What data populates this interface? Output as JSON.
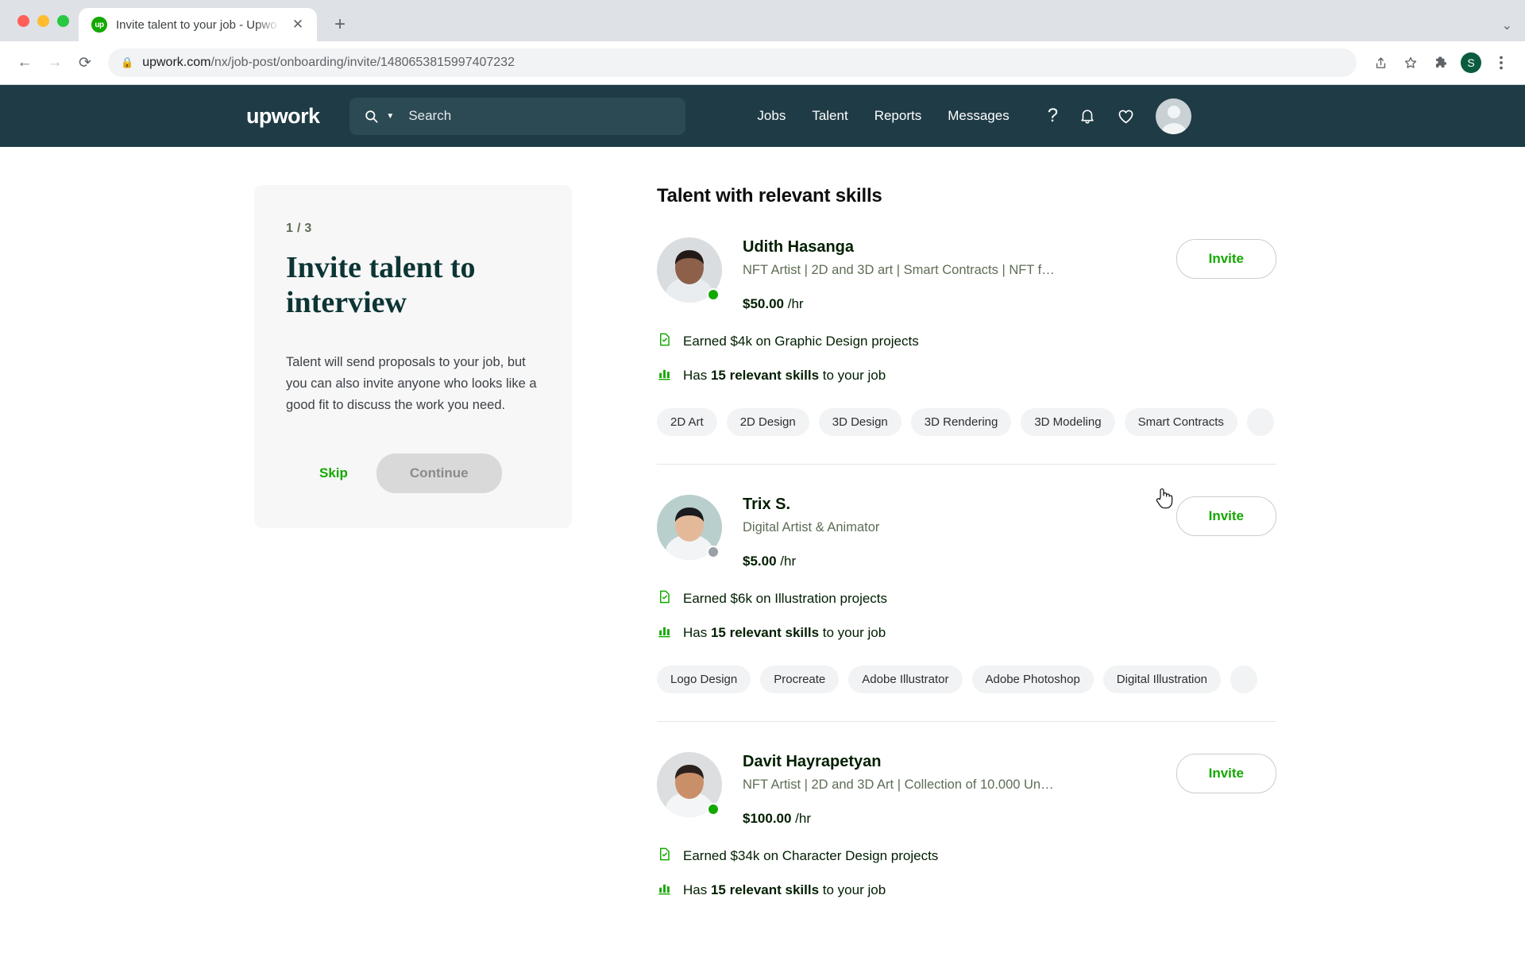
{
  "browser": {
    "tab": {
      "title": "Invite talent to your job - Upwo",
      "favicon_label": "up",
      "close_icon": "close-icon"
    },
    "new_tab_label": "+",
    "tabstrip_menu_icon": "chevron-down-icon",
    "back_icon": "back-arrow-icon",
    "forward_icon": "forward-arrow-icon",
    "reload_icon": "reload-icon",
    "lock_icon": "lock-icon",
    "url_host": "upwork.com",
    "url_path": "/nx/job-post/onboarding/invite/1480653815997407232",
    "url_full": "upwork.com/nx/job-post/onboarding/invite/1480653815997407232",
    "share_icon": "share-icon",
    "bookmark_icon": "star-icon",
    "extensions_icon": "puzzle-icon",
    "profile_initial": "S",
    "menu_icon": "three-dot-menu-icon"
  },
  "header": {
    "logo": "upwork",
    "search_placeholder": "Search",
    "search_icon": "search-icon",
    "search_caret_icon": "chevron-down-icon",
    "nav": [
      {
        "label": "Jobs"
      },
      {
        "label": "Talent"
      },
      {
        "label": "Reports"
      },
      {
        "label": "Messages"
      }
    ],
    "help_icon": "question-mark-icon",
    "notifications_icon": "bell-icon",
    "favorites_icon": "heart-icon",
    "avatar_icon": "user-avatar",
    "bg_color": "#1f3b45"
  },
  "side_card": {
    "step": "1 / 3",
    "title": "Invite talent to interview",
    "body": "Talent will send proposals to your job, but you can also invite anyone who looks like a good fit to discuss the work you need.",
    "skip_label": "Skip",
    "continue_label": "Continue",
    "skip_color": "#14a800"
  },
  "main": {
    "title": "Talent with relevant skills",
    "invite_label": "Invite",
    "next_skills_icon": "chevron-right-icon",
    "earnings_icon": "earnings-badge-icon",
    "skills_icon": "bar-chart-icon",
    "talent": [
      {
        "name": "Udith Hasanga",
        "tagline": "NFT Artist | 2D and 3D art | Smart Contracts | NFT f…",
        "rate": "$50.00",
        "rate_unit": "/hr",
        "status": "online",
        "earnings": "Earned $4k on Graphic Design projects",
        "skills_count_prefix": "Has ",
        "skills_count_bold": "15 relevant skills",
        "skills_count_suffix": " to your job",
        "skills": [
          "2D Art",
          "2D Design",
          "3D Design",
          "3D Rendering",
          "3D Modeling",
          "Smart Contracts"
        ]
      },
      {
        "name": "Trix S.",
        "tagline": "Digital Artist & Animator",
        "rate": "$5.00",
        "rate_unit": "/hr",
        "status": "offline",
        "earnings": "Earned $6k on Illustration projects",
        "skills_count_prefix": "Has ",
        "skills_count_bold": "15 relevant skills",
        "skills_count_suffix": " to your job",
        "skills": [
          "Logo Design",
          "Procreate",
          "Adobe Illustrator",
          "Adobe Photoshop",
          "Digital Illustration"
        ]
      },
      {
        "name": "Davit Hayrapetyan",
        "tagline": "NFT Artist | 2D and 3D Art | Collection of 10.000 Un…",
        "rate": "$100.00",
        "rate_unit": "/hr",
        "status": "online",
        "earnings": "Earned $34k on Character Design projects",
        "skills_count_prefix": "Has ",
        "skills_count_bold": "15 relevant skills",
        "skills_count_suffix": " to your job",
        "skills": []
      }
    ]
  },
  "cursor": {
    "icon": "pointing-hand-cursor"
  }
}
